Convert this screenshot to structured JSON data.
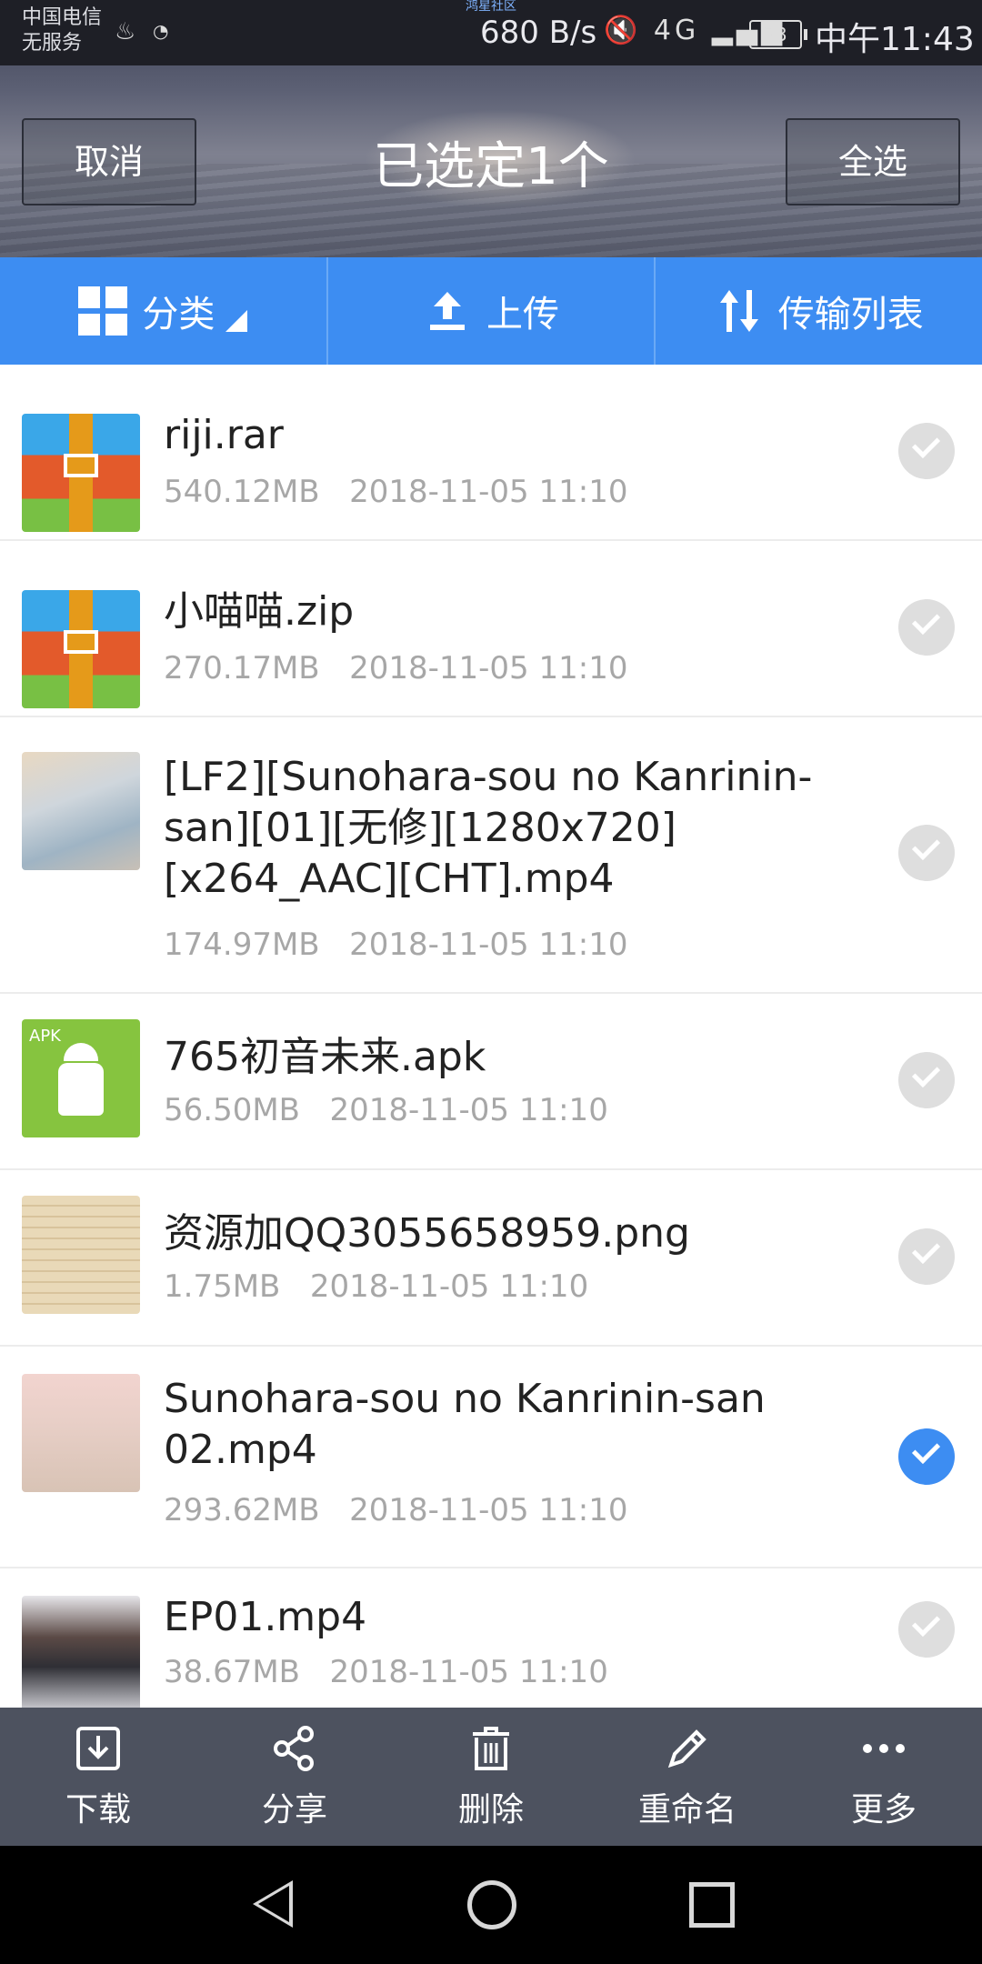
{
  "status_bar": {
    "carrier_line1": "中国电信",
    "carrier_line2": "无服务",
    "center_label": "鸿星社区",
    "net_speed": "680 B/s",
    "signal": "4G",
    "battery": "73",
    "time": "中午11:43"
  },
  "header": {
    "cancel_label": "取消",
    "title": "已选定1个",
    "select_all_label": "全选"
  },
  "tabs": {
    "category_label": "分类",
    "upload_label": "上传",
    "transfer_label": "传输列表"
  },
  "files": [
    {
      "name": "riji.rar",
      "size": "540.12MB",
      "date": "2018-11-05  11:10",
      "selected": false,
      "type": "zip"
    },
    {
      "name": "小喵喵.zip",
      "size": "270.17MB",
      "date": "2018-11-05  11:10",
      "selected": false,
      "type": "zip"
    },
    {
      "name": "[LF2][Sunohara-sou no Kanrinin-san][01][无修][1280x720][x264_AAC][CHT].mp4",
      "size": "174.97MB",
      "date": "2018-11-05  11:10",
      "selected": false,
      "type": "video"
    },
    {
      "name": "765初音未来.apk",
      "size": "56.50MB",
      "date": "2018-11-05  11:10",
      "selected": false,
      "type": "apk"
    },
    {
      "name": "资源加QQ3055658959.png",
      "size": "1.75MB",
      "date": "2018-11-05  11:10",
      "selected": false,
      "type": "image"
    },
    {
      "name": "Sunohara-sou no Kanrinin-san 02.mp4",
      "size": "293.62MB",
      "date": "2018-11-05  11:10",
      "selected": true,
      "type": "video"
    },
    {
      "name": "EP01.mp4",
      "size": "38.67MB",
      "date": "2018-11-05  11:10",
      "selected": false,
      "type": "video"
    }
  ],
  "actions": {
    "download": "下载",
    "share": "分享",
    "delete": "删除",
    "rename": "重命名",
    "more": "更多"
  },
  "colors": {
    "accent": "#3d8df2",
    "action_bar": "#4d525f"
  }
}
